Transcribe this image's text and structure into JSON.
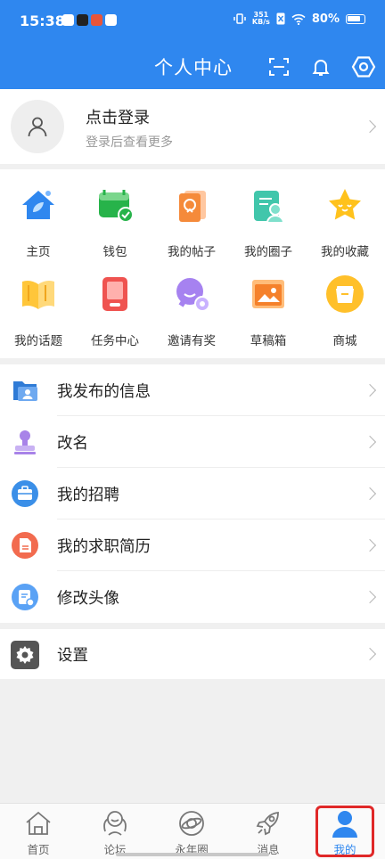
{
  "status": {
    "time": "15:38",
    "net_speed_value": "351",
    "net_speed_unit": "KB/s",
    "battery": "80%"
  },
  "header": {
    "title": "个人中心"
  },
  "profile": {
    "login_title": "点击登录",
    "login_sub": "登录后查看更多"
  },
  "grid": {
    "items": [
      {
        "label": "主页",
        "icon": "home-icon"
      },
      {
        "label": "钱包",
        "icon": "wallet-icon"
      },
      {
        "label": "我的帖子",
        "icon": "my-posts-icon"
      },
      {
        "label": "我的圈子",
        "icon": "my-circle-icon"
      },
      {
        "label": "我的收藏",
        "icon": "star-icon"
      },
      {
        "label": "我的话题",
        "icon": "topic-book-icon"
      },
      {
        "label": "任务中心",
        "icon": "task-center-icon"
      },
      {
        "label": "邀请有奖",
        "icon": "invite-reward-icon"
      },
      {
        "label": "草稿箱",
        "icon": "drafts-icon"
      },
      {
        "label": "商城",
        "icon": "store-bag-icon"
      }
    ]
  },
  "menu": {
    "items": [
      {
        "label": "我发布的信息",
        "icon": "folder-user-icon"
      },
      {
        "label": "改名",
        "icon": "stamp-icon"
      },
      {
        "label": "我的招聘",
        "icon": "briefcase-icon"
      },
      {
        "label": "我的求职简历",
        "icon": "resume-icon"
      },
      {
        "label": "修改头像",
        "icon": "avatar-edit-icon"
      }
    ],
    "settings_label": "设置"
  },
  "bottom_nav": {
    "items": [
      {
        "label": "首页",
        "icon": "home-outline-icon"
      },
      {
        "label": "论坛",
        "icon": "forum-icon"
      },
      {
        "label": "永年圈",
        "icon": "circle-planet-icon"
      },
      {
        "label": "消息",
        "icon": "rocket-icon"
      },
      {
        "label": "我的",
        "icon": "user-icon"
      }
    ],
    "active": "我的"
  },
  "colors": {
    "brand_blue": "#2f87ef",
    "highlight_red": "#e02828"
  }
}
